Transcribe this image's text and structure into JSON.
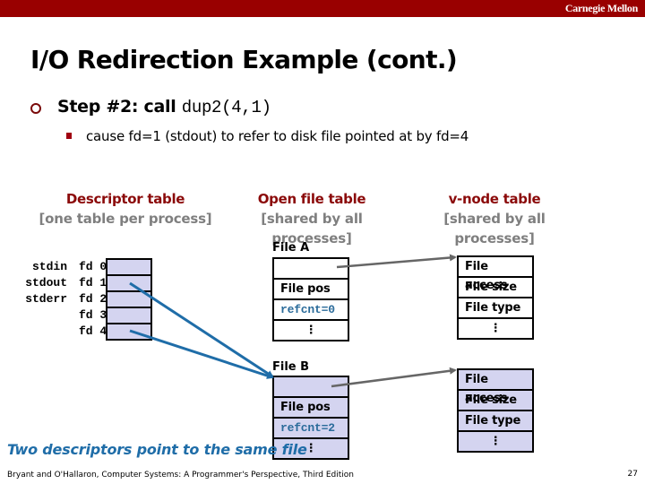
{
  "header": {
    "brand": "Carnegie Mellon"
  },
  "slide": {
    "title": "I/O Redirection Example (cont.)",
    "bullet1": {
      "prefix": "Step #2: call ",
      "code": "dup2(4,1)"
    },
    "bullet2": "cause fd=1 (stdout) to refer to disk file pointed at by fd=4"
  },
  "columns": {
    "descriptor": {
      "title": "Descriptor table",
      "subtitle": "[one table per process]"
    },
    "openfile": {
      "title": "Open file table",
      "subtitle": "[shared by all processes]"
    },
    "vnode": {
      "title": "v-node table",
      "subtitle": "[shared by all processes]"
    }
  },
  "descriptor_table": {
    "stream_labels": [
      "stdin",
      "stdout",
      "stderr"
    ],
    "fd_labels": [
      "fd 0",
      "fd 1",
      "fd 2",
      "fd 3",
      "fd 4"
    ]
  },
  "file_a": {
    "label": "File A",
    "rows": [
      "",
      "File pos",
      "refcnt=0",
      "⋮"
    ],
    "vnode_rows": [
      "File access",
      "File size",
      "File type",
      "⋮"
    ]
  },
  "file_b": {
    "label": "File B",
    "rows": [
      "",
      "File pos",
      "refcnt=2",
      "⋮"
    ],
    "vnode_rows": [
      "File access",
      "File size",
      "File type",
      "⋮"
    ]
  },
  "note": "Two descriptors point to the same file",
  "footer": {
    "citation": "Bryant and O'Hallaron, Computer Systems: A Programmer's Perspective, Third Edition",
    "page": "27"
  },
  "colors": {
    "brand_bar": "#990000",
    "heading": "#8b0a0a",
    "subheading": "#7f7f7f",
    "table_fill": "#d4d4f0",
    "pointer": "#1f6da8",
    "vnode_pointer": "#666666"
  }
}
